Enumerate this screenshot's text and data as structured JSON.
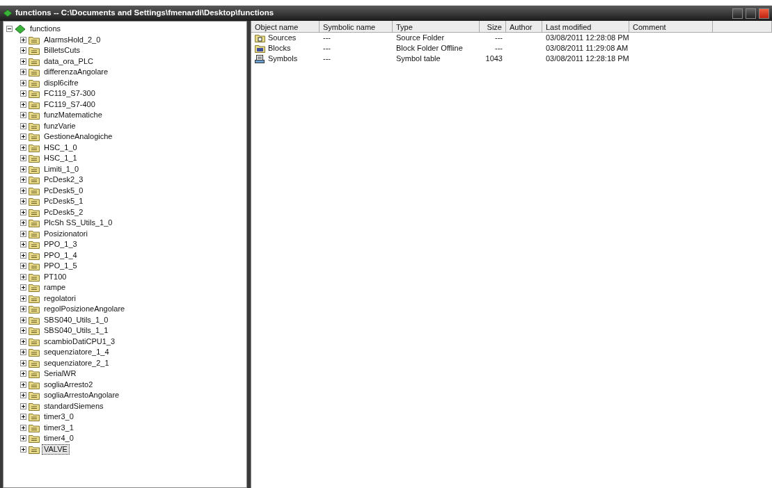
{
  "window": {
    "title": "functions -- C:\\Documents and Settings\\fmenardi\\Desktop\\functions"
  },
  "tree": {
    "label": "functions",
    "expanded": true,
    "selected": false,
    "children": [
      {
        "label": "AlarmsHold_2_0",
        "expanded": false,
        "selected": false
      },
      {
        "label": "BilletsCuts",
        "expanded": false,
        "selected": false
      },
      {
        "label": "data_ora_PLC",
        "expanded": false,
        "selected": false
      },
      {
        "label": "differenzaAngolare",
        "expanded": false,
        "selected": false
      },
      {
        "label": "displ6cifre",
        "expanded": false,
        "selected": false
      },
      {
        "label": "FC119_S7-300",
        "expanded": false,
        "selected": false
      },
      {
        "label": "FC119_S7-400",
        "expanded": false,
        "selected": false
      },
      {
        "label": "funzMatematiche",
        "expanded": false,
        "selected": false
      },
      {
        "label": "funzVarie",
        "expanded": false,
        "selected": false
      },
      {
        "label": "GestioneAnalogiche",
        "expanded": false,
        "selected": false
      },
      {
        "label": "HSC_1_0",
        "expanded": false,
        "selected": false
      },
      {
        "label": "HSC_1_1",
        "expanded": false,
        "selected": false
      },
      {
        "label": "Limiti_1_0",
        "expanded": false,
        "selected": false
      },
      {
        "label": "PcDesk2_3",
        "expanded": false,
        "selected": false
      },
      {
        "label": "PcDesk5_0",
        "expanded": false,
        "selected": false
      },
      {
        "label": "PcDesk5_1",
        "expanded": false,
        "selected": false
      },
      {
        "label": "PcDesk5_2",
        "expanded": false,
        "selected": false
      },
      {
        "label": "PlcSh SS_Utils_1_0",
        "expanded": false,
        "selected": false
      },
      {
        "label": "Posizionatori",
        "expanded": false,
        "selected": false
      },
      {
        "label": "PPO_1_3",
        "expanded": false,
        "selected": false
      },
      {
        "label": "PPO_1_4",
        "expanded": false,
        "selected": false
      },
      {
        "label": "PPO_1_5",
        "expanded": false,
        "selected": false
      },
      {
        "label": "PT100",
        "expanded": false,
        "selected": false
      },
      {
        "label": "rampe",
        "expanded": false,
        "selected": false
      },
      {
        "label": "regolatori",
        "expanded": false,
        "selected": false
      },
      {
        "label": "regolPosizioneAngolare",
        "expanded": false,
        "selected": false
      },
      {
        "label": "SBS040_Utils_1_0",
        "expanded": false,
        "selected": false
      },
      {
        "label": "SBS040_Utils_1_1",
        "expanded": false,
        "selected": false
      },
      {
        "label": "scambioDatiCPU1_3",
        "expanded": false,
        "selected": false
      },
      {
        "label": "sequenziatore_1_4",
        "expanded": false,
        "selected": false
      },
      {
        "label": "sequenziatore_2_1",
        "expanded": false,
        "selected": false
      },
      {
        "label": "SerialWR",
        "expanded": false,
        "selected": false
      },
      {
        "label": "sogliaArresto2",
        "expanded": false,
        "selected": false
      },
      {
        "label": "sogliaArrestoAngolare",
        "expanded": false,
        "selected": false
      },
      {
        "label": "standardSiemens",
        "expanded": false,
        "selected": false
      },
      {
        "label": "timer3_0",
        "expanded": false,
        "selected": false
      },
      {
        "label": "timer3_1",
        "expanded": false,
        "selected": false
      },
      {
        "label": "timer4_0",
        "expanded": false,
        "selected": false
      },
      {
        "label": "VALVE",
        "expanded": false,
        "selected": true
      }
    ]
  },
  "table": {
    "columns": [
      "Object name",
      "Symbolic name",
      "Type",
      "Size",
      "Author",
      "Last modified",
      "Comment"
    ],
    "rows": [
      {
        "kind": "source",
        "object_name": "Sources",
        "symbolic_name": "---",
        "type": "Source Folder",
        "size": "---",
        "last_modified": "03/08/2011 12:28:08 PM"
      },
      {
        "kind": "blocks",
        "object_name": "Blocks",
        "symbolic_name": "---",
        "type": "Block Folder Offline",
        "size": "---",
        "last_modified": "03/08/2011 11:29:08 AM"
      },
      {
        "kind": "symbols",
        "object_name": "Symbols",
        "symbolic_name": "---",
        "type": "Symbol table",
        "size": "1043",
        "last_modified": "03/08/2011 12:28:18 PM"
      }
    ]
  }
}
